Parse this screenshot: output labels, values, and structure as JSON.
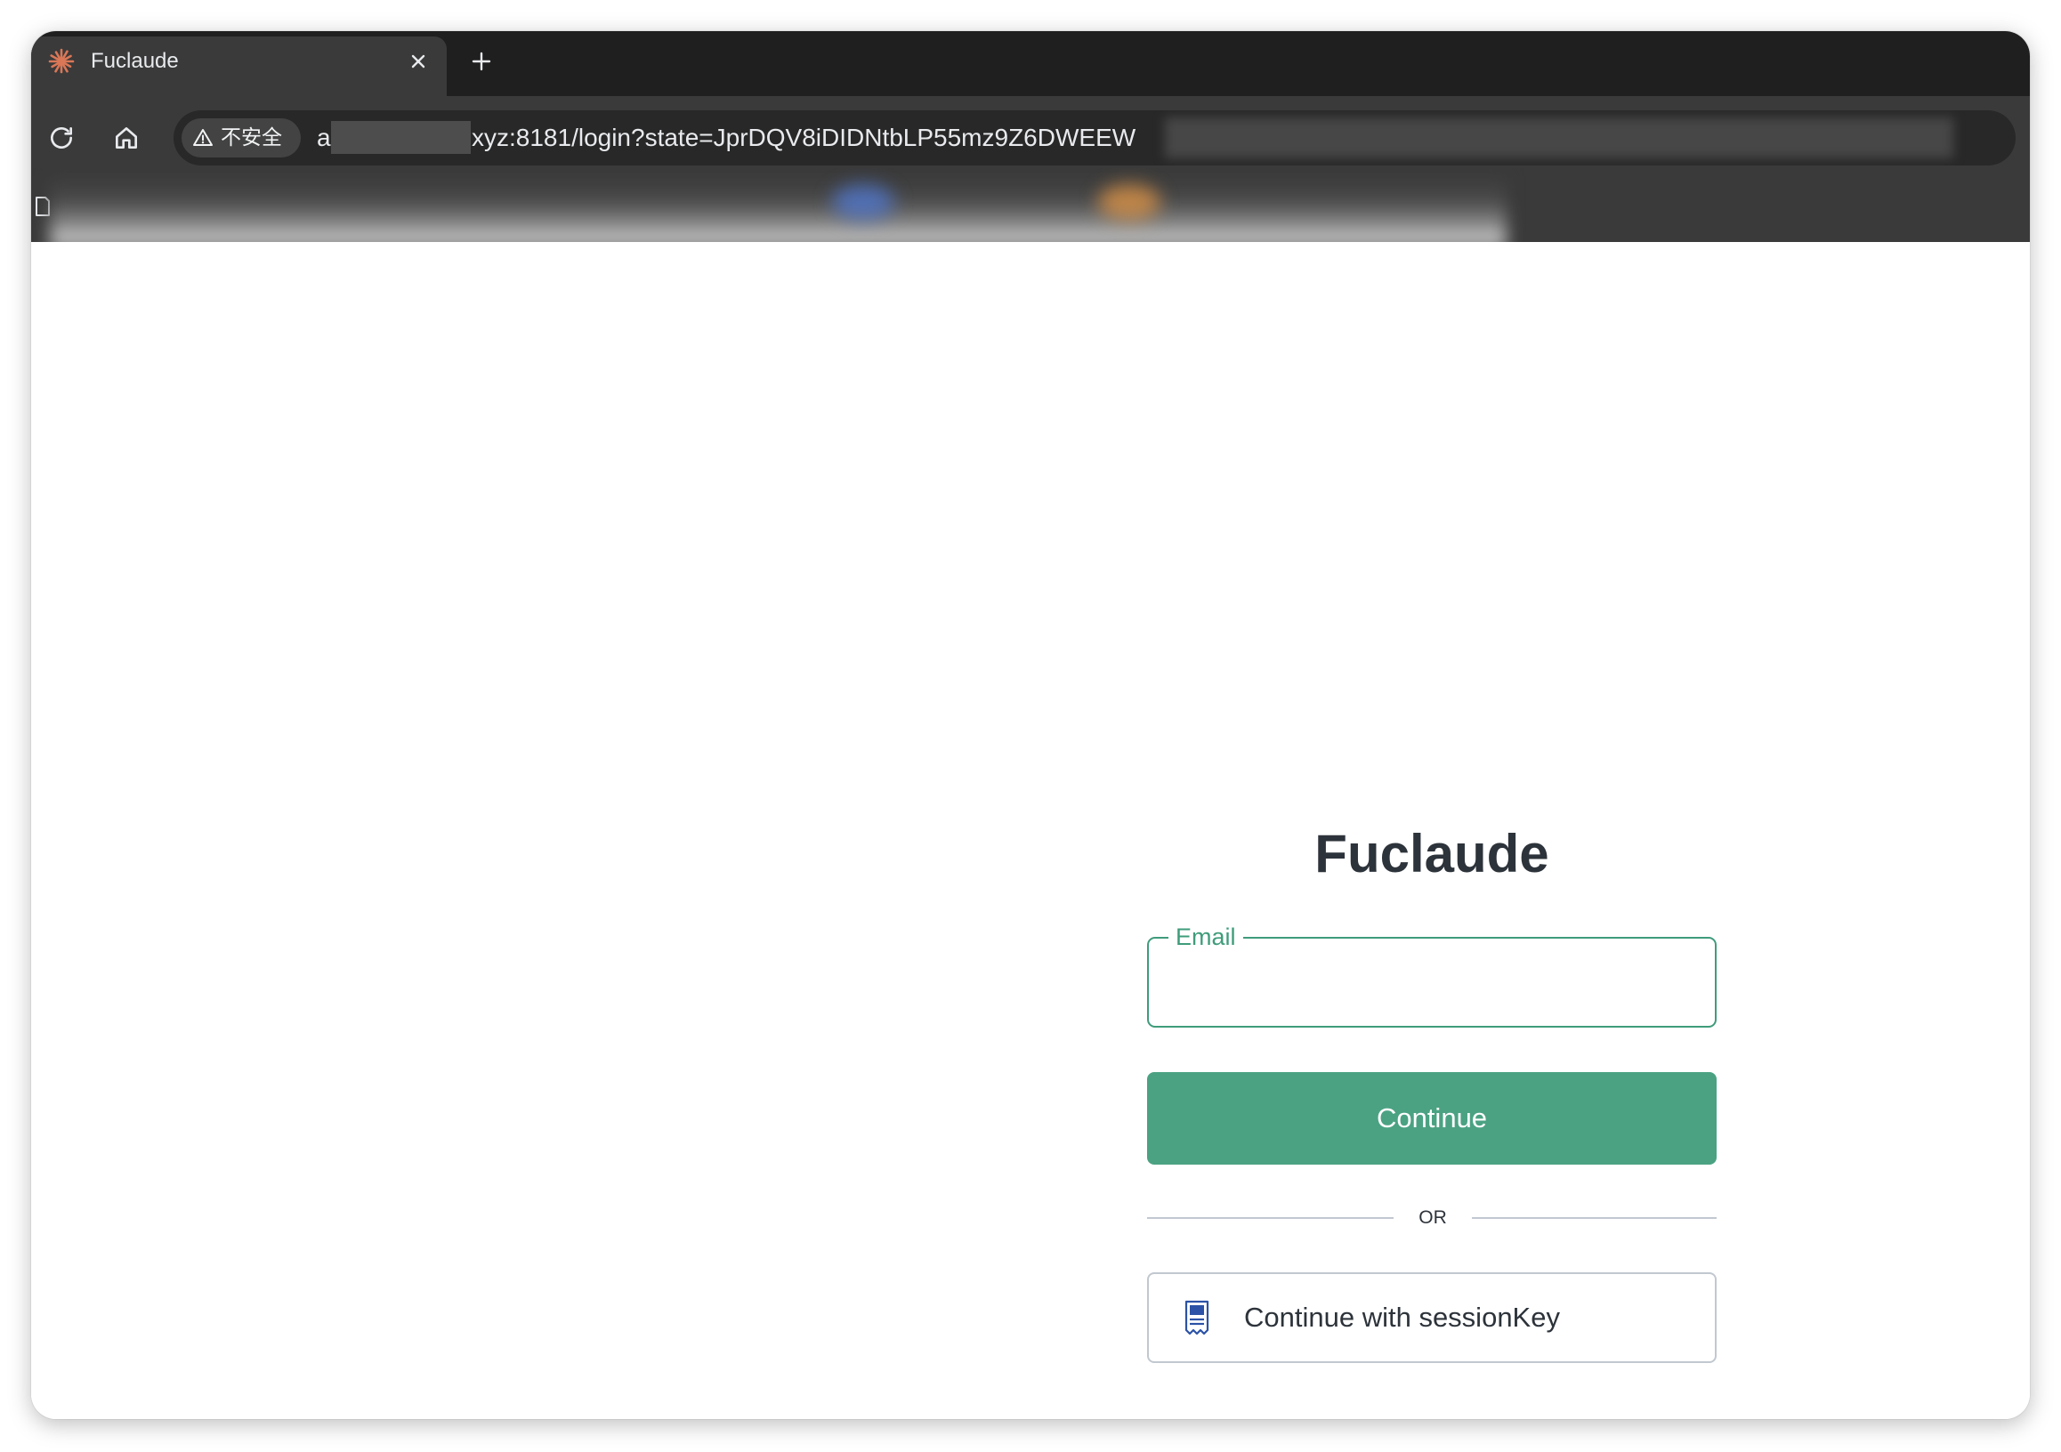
{
  "browser": {
    "tab": {
      "title": "Fuclaude",
      "favicon": "claude-starburst-icon",
      "close_icon": "close-icon"
    },
    "new_tab_icon": "plus-icon",
    "toolbar": {
      "reload_icon": "reload-icon",
      "home_icon": "home-icon"
    },
    "address": {
      "security_icon": "warning-triangle-icon",
      "security_label": "不安全",
      "url_prefix": "a",
      "url_rest": "xyz:8181/login?state=JprDQV8iDIDNtbLP55mz9Z6DWEEW"
    },
    "bookmarks": {
      "doc_icon": "document-icon"
    }
  },
  "page": {
    "title": "Fuclaude",
    "email": {
      "label": "Email",
      "value": ""
    },
    "continue_label": "Continue",
    "divider_label": "OR",
    "session_button": {
      "icon": "receipt-icon",
      "label": "Continue with sessionKey"
    }
  },
  "colors": {
    "accent": "#4ba283",
    "field_border": "#3f9c7b",
    "heading": "#2d333a",
    "muted_line": "#c2c8d0",
    "favicon": "#d97757",
    "session_icon": "#2b52a6"
  }
}
